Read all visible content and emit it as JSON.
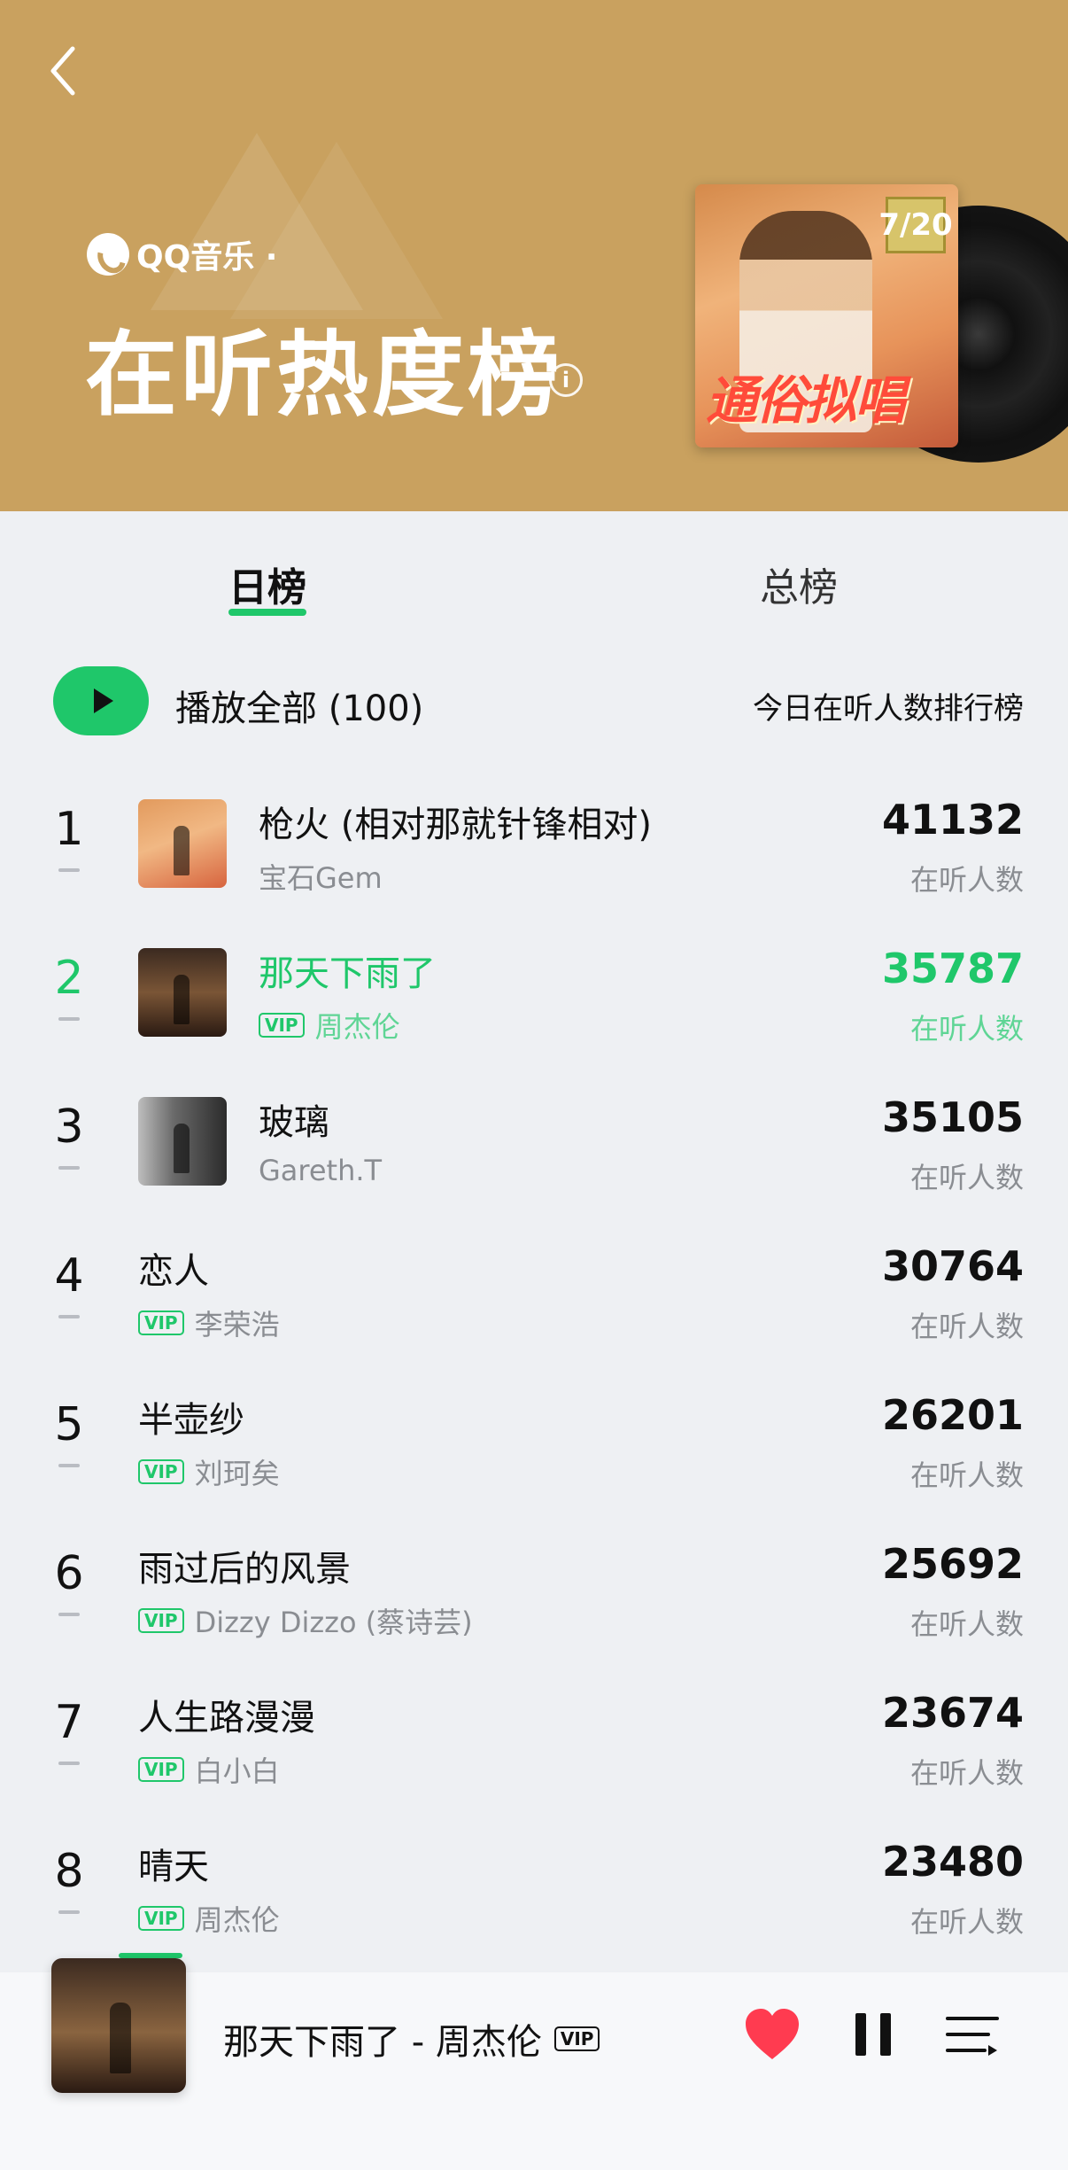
{
  "header": {
    "brand": "QQ音乐 · ",
    "title": "在听热度榜",
    "info": "i",
    "cover": {
      "date_tag": "7/20",
      "cover_title": "通俗拟唱"
    }
  },
  "tabs": [
    {
      "label": "日榜",
      "active": true
    },
    {
      "label": "总榜",
      "active": false
    }
  ],
  "play_all": {
    "label": "播放全部 (100)",
    "description": "今日在听人数排行榜"
  },
  "listen_label": "在听人数",
  "vip_label": "VIP",
  "songs": [
    {
      "rank": "1",
      "title": "枪火 (相对那就针锋相对)",
      "artist": "宝石Gem",
      "count": "41132",
      "vip": false,
      "thumb": "t1"
    },
    {
      "rank": "2",
      "title": "那天下雨了",
      "artist": "周杰伦",
      "count": "35787",
      "vip": true,
      "thumb": "t2",
      "current": true
    },
    {
      "rank": "3",
      "title": "玻璃",
      "artist": "Gareth.T",
      "count": "35105",
      "vip": false,
      "thumb": "t3"
    },
    {
      "rank": "4",
      "title": "恋人",
      "artist": "李荣浩",
      "count": "30764",
      "vip": true
    },
    {
      "rank": "5",
      "title": "半壶纱",
      "artist": "刘珂矣",
      "count": "26201",
      "vip": true
    },
    {
      "rank": "6",
      "title": "雨过后的风景",
      "artist": "Dizzy Dizzo (蔡诗芸)",
      "count": "25692",
      "vip": true
    },
    {
      "rank": "7",
      "title": "人生路漫漫",
      "artist": "白小白",
      "count": "23674",
      "vip": true
    },
    {
      "rank": "8",
      "title": "晴天",
      "artist": "周杰伦",
      "count": "23480",
      "vip": true
    }
  ],
  "player": {
    "now_playing": "那天下雨了 - 周杰伦",
    "vip": "VIP"
  },
  "colors": {
    "header_bg": "#c9a15f",
    "accent": "#1fc76a",
    "heart": "#ff3b50"
  }
}
